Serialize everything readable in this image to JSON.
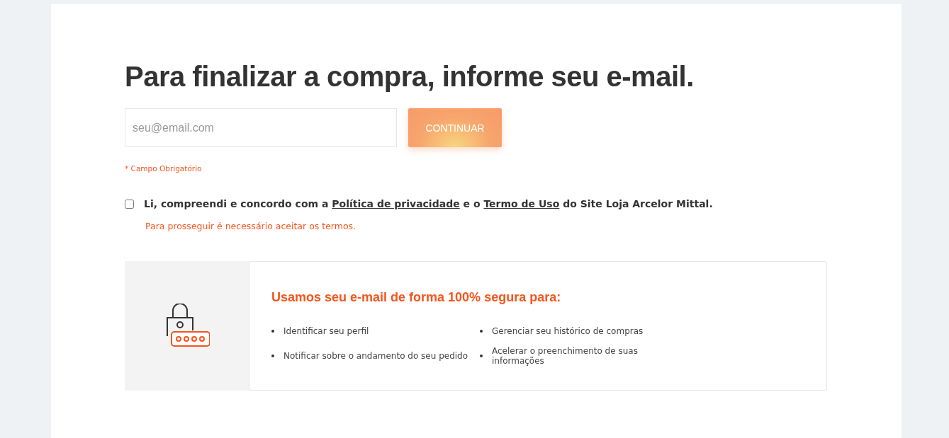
{
  "heading": "Para finalizar a compra, informe seu e-mail.",
  "email_field": {
    "placeholder": "seu@email.com"
  },
  "continue_button": "CONTINUAR",
  "required_note": "* Campo Obrigatório",
  "consent": {
    "checked": false,
    "before": "Li, compreendi e concordo com a",
    "privacy_link": "Política de privacidade",
    "middle": "e o",
    "terms_link": "Termo de Uso",
    "after": "do Site Loja Arcelor Mittal."
  },
  "consent_error": "Para prosseguir é necessário aceitar os termos.",
  "info": {
    "title": "Usamos seu e-mail de forma 100% segura para:",
    "items": [
      "Identificar seu perfil",
      "Gerenciar seu histórico de compras",
      "Notificar sobre o andamento do seu pedido",
      "Acelerar o preenchimento de suas informações"
    ]
  }
}
